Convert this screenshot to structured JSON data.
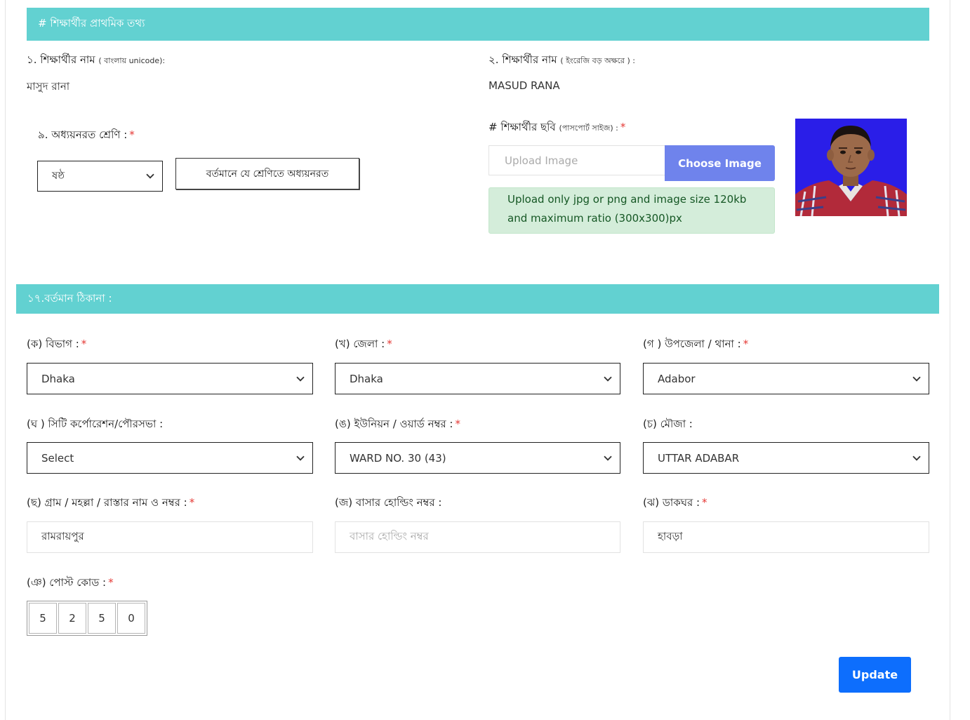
{
  "primary_info": {
    "header": "# শিক্ষার্থীর প্রাথমিক তথ্য",
    "name_bn_label": "১. শিক্ষার্থীর নাম",
    "name_bn_hint": "( বাংলায় unicode):",
    "name_bn_value": "মাসুদ রানা",
    "name_en_label": "২. শিক্ষার্থীর নাম",
    "name_en_hint": "( ইংরেজি বড় অক্ষরে ) :",
    "name_en_value": "MASUD RANA",
    "class_label": "৯. অধ্যয়নরত শ্রেণি :",
    "class_value": "ষষ্ঠ",
    "class_hint": "বর্তমানে যে শ্রেণিতে অধ্যয়নরত",
    "photo_label": "# শিক্ষার্থীর ছবি",
    "photo_hint": "(পাসপোর্ট সাইজ) :",
    "upload_placeholder": "Upload Image",
    "choose_button": "Choose Image",
    "upload_note": "Upload only jpg or png and image size 120kb and maximum ratio (300x300)px"
  },
  "address": {
    "header": "১৭.বর্তমান ঠিকানা :",
    "division_label": "(ক) বিভাগ :",
    "division_value": "Dhaka",
    "district_label": "(খ) জেলা :",
    "district_value": "Dhaka",
    "upazila_label": "(গ ) উপজেলা / থানা :",
    "upazila_value": "Adabor",
    "city_label": "(ঘ ) সিটি কর্পোরেশন/পৌরসভা :",
    "city_value": "Select",
    "union_label": "(ঙ) ইউনিয়ন / ওয়ার্ড নম্বর :",
    "union_value": "WARD NO. 30 (43)",
    "mouza_label": "(চ) মৌজা :",
    "mouza_value": "UTTAR ADABAR",
    "village_label": "(ছ) গ্রাম / মহল্লা / রাস্তার নাম ও নম্বর :",
    "village_value": "রামরায়পুর",
    "holding_label": "(জ) বাসার হোল্ডিং নম্বর :",
    "holding_placeholder": "বাসার হোল্ডিং নম্বর",
    "postoffice_label": "(ঝ) ডাকঘর :",
    "postoffice_value": "হাবড়া",
    "postcode_label": "(ঞ) পোস্ট কোড :",
    "postcode_digits": [
      "5",
      "2",
      "5",
      "0"
    ]
  },
  "required_mark": "*",
  "update_button": "Update",
  "colors": {
    "section_header": "#62d1d1",
    "choose_button": "#6f83ec",
    "update_button": "#0d6efd",
    "notice_bg": "#d4edda",
    "required": "#e53935"
  },
  "icons": {
    "dropdown": "chevron-down-icon"
  }
}
